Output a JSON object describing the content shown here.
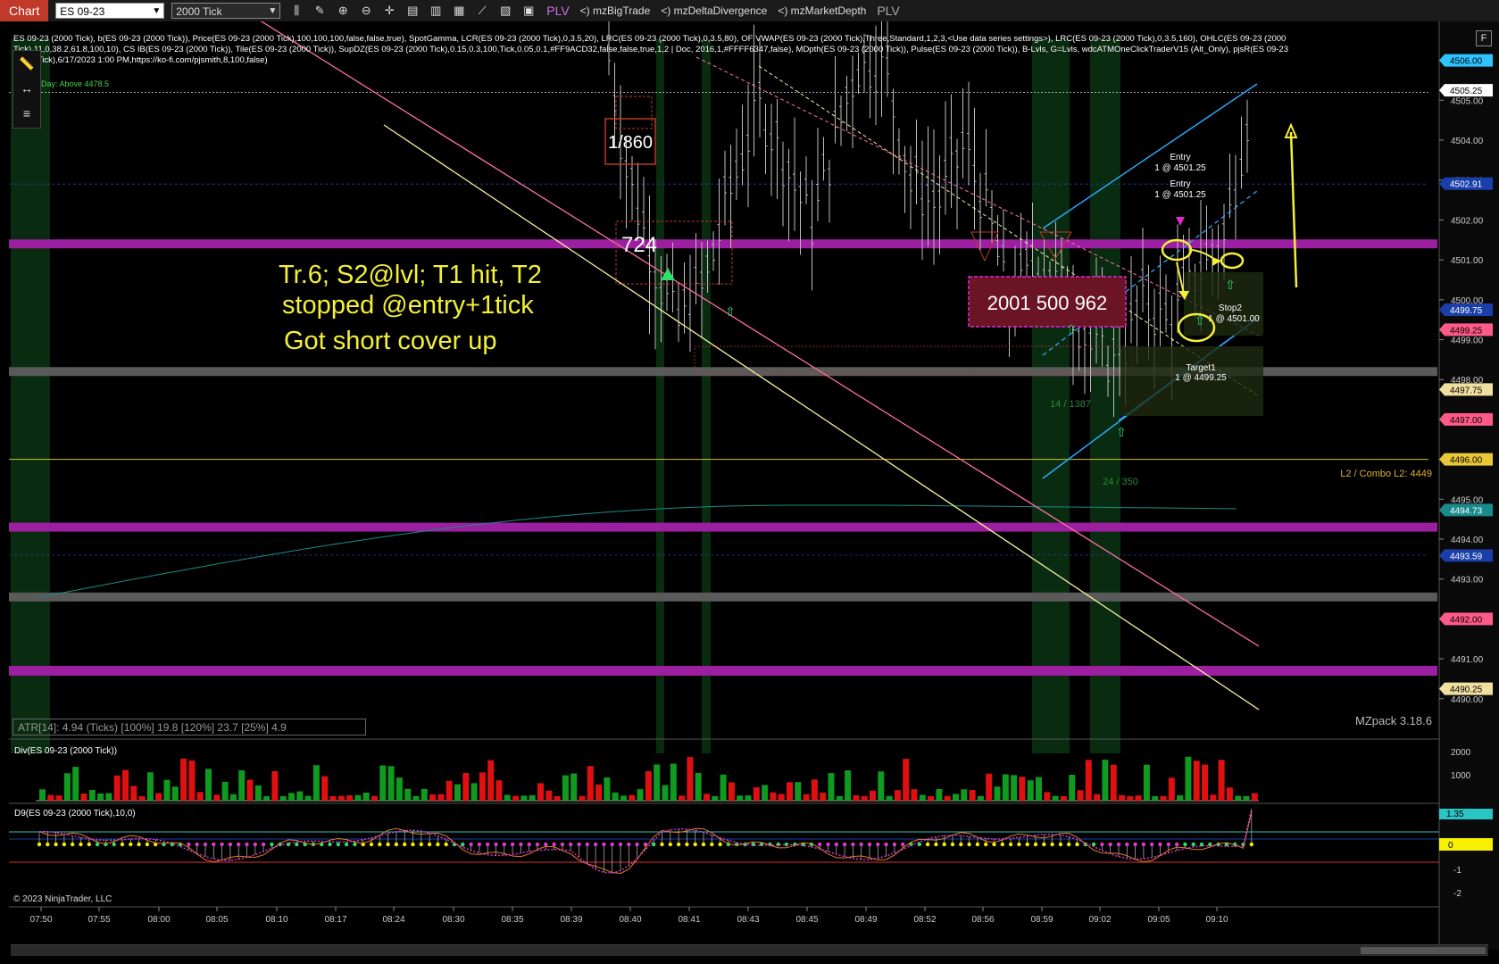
{
  "toolbar": {
    "chart_tab": "Chart",
    "instrument": "ES 09-23",
    "interval": "2000 Tick",
    "plv_label": "PLV",
    "addons": [
      "<) mzBigTrade",
      "<) mzDeltaDivergence",
      "<) mzMarketDepth"
    ],
    "plv_right": "PLV"
  },
  "header": {
    "line1": "ES 09-23 (2000 Tick), b(ES 09-23 (2000 Tick)), Price(ES 09-23 (2000 Tick),100,100,100,false,false,true), SpotGamma, LCR(ES 09-23 (2000 Tick),0,3.5,20), LRC(ES 09-23 (2000 Tick),0,3.5,80), OF VWAP(ES 09-23 (2000 Tick),Three,Standard,1,2,3,<Use data series settings>), LRC(ES 09-23 (2000 Tick),0,3.5,160), OHLC(ES 09-23 (2000",
    "line2": "Tick),11,0,38.2,61.8,100,10), CS IB(ES 09-23 (2000 Tick)), Tile(ES 09-23 (2000 Tick)), SupDZ(ES 09-23 (2000 Tick),0.15,0.3,100,Tick,0.05,0.1,#FF9ACD32,false,false,true,1,2 | Doc, 2016,1,#FFFF6347,false), MDpth(ES 09-23 (2000 Tick)), Pulse(ES 09-23 (2000 Tick)), B-Lvls, G=Lvls, wdcATMOneClickTraderV15 (Alt_Only), pjsR(ES 09-23",
    "line3": "(2000 Tick),6/17/2023 1:00 PM,https://ko-fi.com/pjsmith,8,100,false)",
    "day_above": "Day: Above 4478.5"
  },
  "annotations": {
    "line1": "Tr.6; S2@lvl; T1 hit, T2",
    "line2": "stopped @entry+1tick",
    "line3": "Got short cover up"
  },
  "chart_labels": {
    "big_1860": "1/860",
    "big_724": "724",
    "big_overlap": "2001 500 962",
    "entry1": "Entry",
    "entry1_qty": "1 @ 4501.25",
    "entry2": "Entry",
    "entry2_qty": "1 @ 4501.25",
    "stop2": "Stop2",
    "stop2_qty": "1 @ 4501.00",
    "target1": "Target1",
    "target1_qty": "1 @ 4499.25",
    "vol_14": "14 / 1387",
    "vol_24": "24 / 350",
    "l2_combo": "L2 / Combo L2: 4449",
    "mzpack": "MZpack 3.18.6"
  },
  "price_axis": {
    "ticks": [
      "4506.00",
      "4505.00",
      "4504.00",
      "4503.00",
      "4502.00",
      "4501.00",
      "4500.00",
      "4499.00",
      "4498.00",
      "4497.00",
      "4496.00",
      "4495.00",
      "4494.00",
      "4493.00",
      "4492.00",
      "4491.00",
      "4490.00"
    ],
    "markers": [
      {
        "label": "4506.00",
        "color": "#2ec4ff",
        "text_color": "#000"
      },
      {
        "label": "4505.25",
        "color": "#ffffff",
        "text_color": "#000"
      },
      {
        "label": "4502.91",
        "color": "#1a3fa8",
        "text_color": "#fff"
      },
      {
        "label": "4499.75",
        "color": "#1a3fa8",
        "text_color": "#fff"
      },
      {
        "label": "4499.25",
        "color": "#ff5a8a",
        "text_color": "#000"
      },
      {
        "label": "4497.75",
        "color": "#f0e0a0",
        "text_color": "#000"
      },
      {
        "label": "4497.00",
        "color": "#ff5a8a",
        "text_color": "#000"
      },
      {
        "label": "4496.00",
        "color": "#e8c838",
        "text_color": "#000"
      },
      {
        "label": "4494.73",
        "color": "#1a8a8a",
        "text_color": "#fff"
      },
      {
        "label": "4493.59",
        "color": "#1a3fa8",
        "text_color": "#fff"
      },
      {
        "label": "4492.00",
        "color": "#ff5a8a",
        "text_color": "#000"
      },
      {
        "label": "4490.25",
        "color": "#f0e0a0",
        "text_color": "#000"
      }
    ]
  },
  "time_axis": [
    "07:50",
    "07:55",
    "08:00",
    "08:05",
    "08:10",
    "08:17",
    "08:24",
    "08:30",
    "08:35",
    "08:39",
    "08:40",
    "08:41",
    "08:43",
    "08:45",
    "08:49",
    "08:52",
    "08:56",
    "08:59",
    "09:02",
    "09:05",
    "09:10"
  ],
  "atr": "ATR[14]: 4.94 (Ticks) [100%] 19.8  [120%] 23.7  [25%] 4.9",
  "div_pane": {
    "label": "Div(ES 09-23 (2000 Tick))",
    "ticks": [
      "2000",
      "1000"
    ]
  },
  "d9_pane": {
    "label": "D9(ES 09-23 (2000 Tick),10,0)",
    "ticks": [
      "-1",
      "-2"
    ],
    "marker_top": "1.35",
    "marker_zero": "0"
  },
  "copyright": "© 2023 NinjaTrader, LLC",
  "corner_button": "F",
  "side_icons": [
    "ruler-icon",
    "move-icon",
    "menu-icon"
  ],
  "colors": {
    "magenta_band": "#9b1fa0",
    "gray_band": "#5a5a5a",
    "bar": "#bdbdbd",
    "pink_line": "#ff6fa8",
    "yellow_line": "#f7f0a8",
    "blue_line": "#2aa8ff",
    "annotation": "#f4f03a"
  }
}
